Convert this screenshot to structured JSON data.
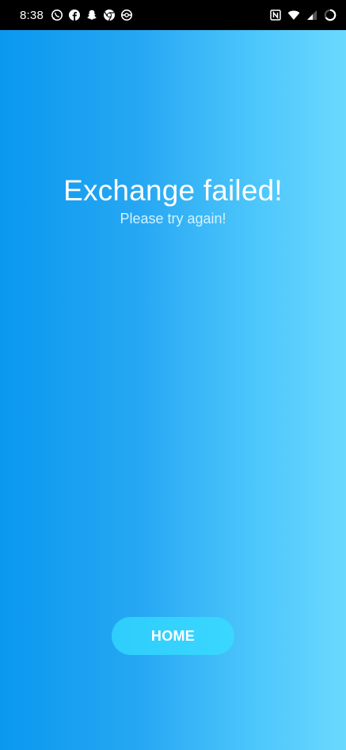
{
  "status_bar": {
    "time": "8:38",
    "left_icons": [
      "whatsapp-icon",
      "facebook-icon",
      "snapchat-icon",
      "chrome-icon",
      "pokeball-icon"
    ],
    "right_icons": [
      "nfc-icon",
      "wifi-icon",
      "signal-icon",
      "battery-charging-icon"
    ]
  },
  "result": {
    "title": "Exchange failed!",
    "subtitle": "Please try again!"
  },
  "actions": {
    "home_label": "HOME"
  },
  "colors": {
    "gradient_start": "#0a98ef",
    "gradient_end": "#6ad9ff",
    "button": "#34d3fd",
    "text": "#ffffff"
  }
}
